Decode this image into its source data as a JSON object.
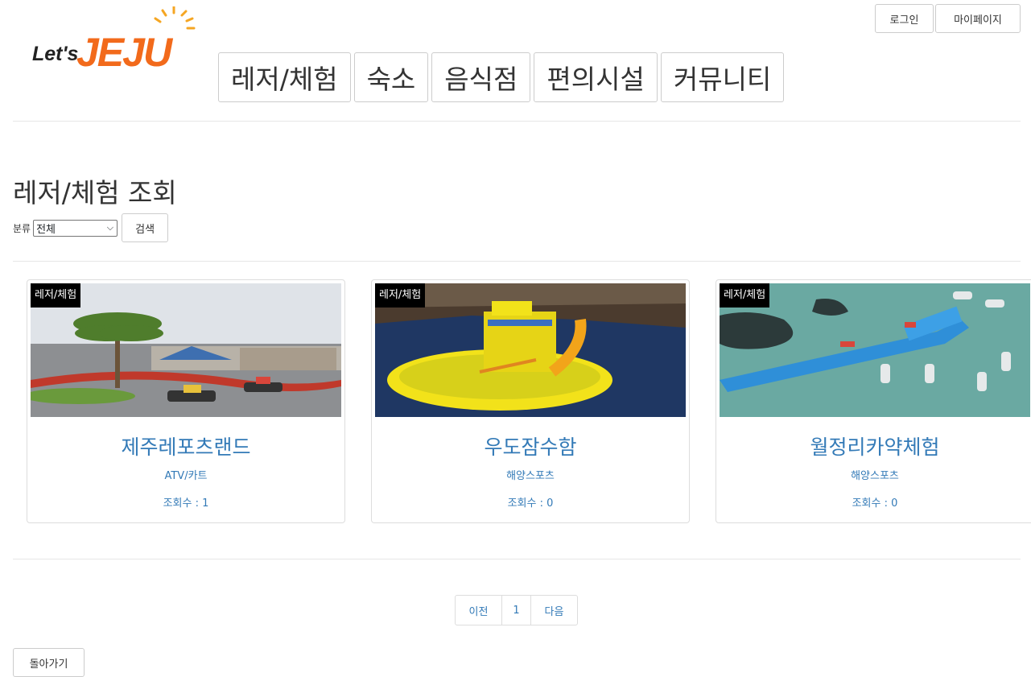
{
  "header": {
    "logo_text": "Let'sJEJU",
    "login_label": "로그인",
    "mypage_label": "마이페이지"
  },
  "nav": [
    {
      "label": "레저/체험"
    },
    {
      "label": "숙소"
    },
    {
      "label": "음식점"
    },
    {
      "label": "편의시설"
    },
    {
      "label": "커뮤니티"
    }
  ],
  "main": {
    "title": "레저/체험 조회",
    "filter_label": "분류",
    "filter_selected": "전체",
    "search_label": "검색"
  },
  "cards": [
    {
      "badge": "레저/체험",
      "title": "제주레포츠랜드",
      "category": "ATV/카트",
      "views": "조회수 : 1"
    },
    {
      "badge": "레저/체험",
      "title": "우도잠수함",
      "category": "해양스포츠",
      "views": "조회수 : 0"
    },
    {
      "badge": "레저/체험",
      "title": "월정리카약체험",
      "category": "해양스포츠",
      "views": "조회수 : 0"
    }
  ],
  "pagination": {
    "prev": "이전",
    "current": "1",
    "next": "다음"
  },
  "back_label": "돌아가기",
  "colors": {
    "link": "#337ab7",
    "logo_orange": "#f26a1b",
    "badge_bg": "#000000"
  }
}
